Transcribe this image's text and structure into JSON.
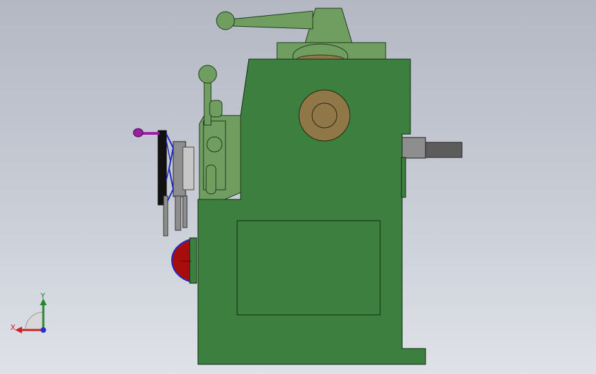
{
  "viewport": {
    "background_top": "#b3b8c3",
    "background_bottom": "#dfe2e8"
  },
  "model": {
    "body_color": "#3c7f3e",
    "light_green": "#6f9e60",
    "bronze": "#8f7748",
    "gray": "#8e8e8e",
    "dark_gray": "#5c5c5c",
    "black": "#111111",
    "red": "#a80d0d",
    "blue": "#1f2cc9",
    "magenta": "#9a1ea0"
  },
  "triad": {
    "x_label": "X",
    "y_label": "Y",
    "x_color": "#cc2222",
    "y_color": "#1f8a2a",
    "z_color": "#2233cc"
  }
}
